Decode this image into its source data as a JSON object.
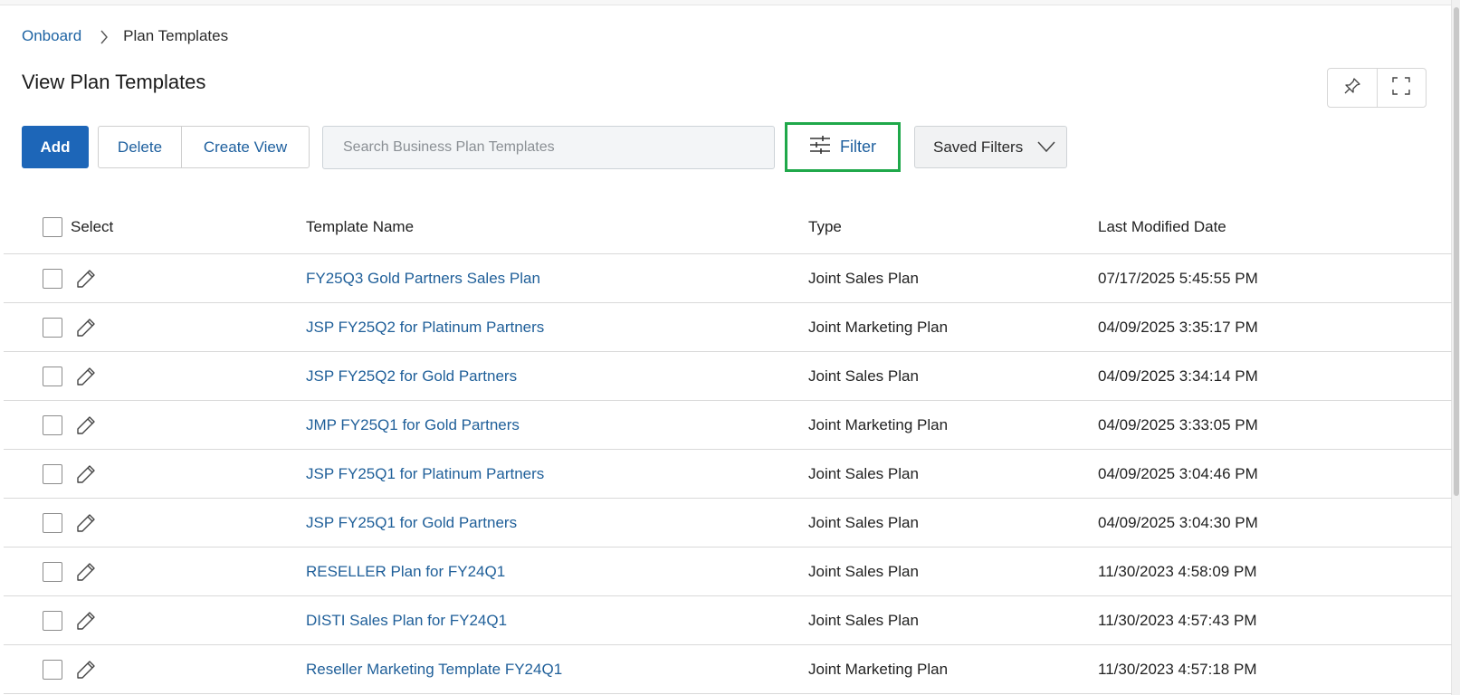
{
  "breadcrumb": {
    "root": "Onboard",
    "current": "Plan Templates"
  },
  "page": {
    "title": "View Plan Templates"
  },
  "toolbar": {
    "add_label": "Add",
    "delete_label": "Delete",
    "create_view_label": "Create View",
    "search_placeholder": "Search Business Plan Templates",
    "filter_label": "Filter",
    "saved_filters_label": "Saved Filters"
  },
  "icons": {
    "pin": "pin-icon",
    "fullscreen": "fullscreen-icon",
    "filter": "sliders-icon",
    "chevron": "chevron-down-icon",
    "edit": "pencil-icon",
    "breadcrumb_sep": "chevron-right-icon"
  },
  "colors": {
    "accent": "#1d66b8",
    "link": "#1f5f99",
    "highlight": "#1fa84a"
  },
  "table": {
    "columns": {
      "select": "Select",
      "name": "Template Name",
      "type": "Type",
      "date": "Last Modified Date"
    },
    "rows": [
      {
        "name": "FY25Q3 Gold Partners Sales Plan",
        "type": "Joint Sales Plan",
        "date": "07/17/2025 5:45:55 PM"
      },
      {
        "name": "JSP FY25Q2 for Platinum Partners",
        "type": "Joint Marketing Plan",
        "date": "04/09/2025 3:35:17 PM"
      },
      {
        "name": "JSP FY25Q2 for Gold Partners",
        "type": "Joint Sales Plan",
        "date": "04/09/2025 3:34:14 PM"
      },
      {
        "name": "JMP FY25Q1 for Gold Partners",
        "type": "Joint Marketing Plan",
        "date": "04/09/2025 3:33:05 PM"
      },
      {
        "name": "JSP FY25Q1 for Platinum Partners",
        "type": "Joint Sales Plan",
        "date": "04/09/2025 3:04:46 PM"
      },
      {
        "name": "JSP FY25Q1 for Gold Partners",
        "type": "Joint Sales Plan",
        "date": "04/09/2025 3:04:30 PM"
      },
      {
        "name": "RESELLER Plan for FY24Q1",
        "type": "Joint Sales Plan",
        "date": "11/30/2023 4:58:09 PM"
      },
      {
        "name": "DISTI Sales Plan for FY24Q1",
        "type": "Joint Sales Plan",
        "date": "11/30/2023 4:57:43 PM"
      },
      {
        "name": "Reseller Marketing Template FY24Q1",
        "type": "Joint Marketing Plan",
        "date": "11/30/2023 4:57:18 PM"
      }
    ]
  }
}
